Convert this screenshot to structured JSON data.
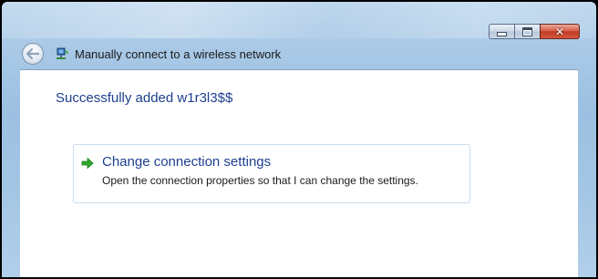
{
  "window": {
    "title": "Manually connect to a wireless network",
    "controls": {
      "minimize_icon": "minimize-icon",
      "maximize_icon": "maximize-icon",
      "close_icon": "close-icon",
      "close_glyph": "✕"
    }
  },
  "nav": {
    "back_icon": "back-arrow-icon",
    "network_icon": "wireless-network-icon"
  },
  "main": {
    "heading": "Successfully added w1r3l3$$",
    "option": {
      "icon": "green-arrow-icon",
      "title": "Change connection settings",
      "description": "Open the connection properties so that I can change the settings."
    }
  },
  "colors": {
    "link_blue": "#1e3f8f",
    "close_red": "#c23b24",
    "arrow_green": "#2fa82f"
  }
}
